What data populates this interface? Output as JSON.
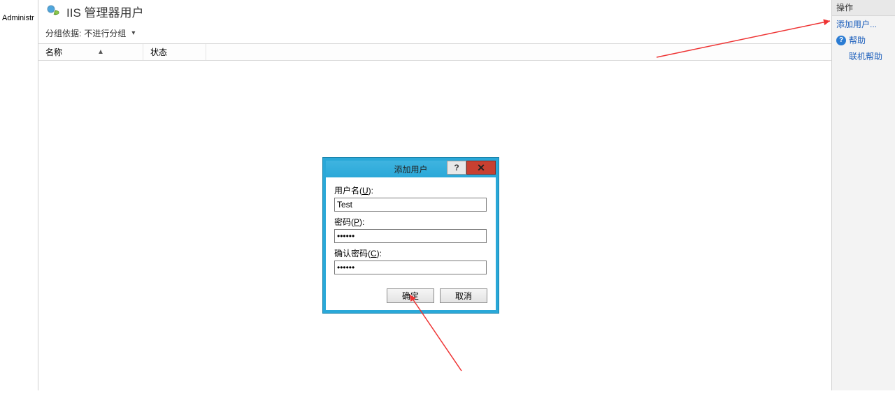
{
  "tree": {
    "root_label": "Administr"
  },
  "page": {
    "title": "IIS 管理器用户",
    "group_label": "分组依据:",
    "group_value": "不进行分组",
    "columns": {
      "name": "名称",
      "status": "状态"
    }
  },
  "actions": {
    "panel_title": "操作",
    "add_user": "添加用户...",
    "help": "帮助",
    "online_help": "联机帮助"
  },
  "dialog": {
    "title": "添加用户",
    "help_glyph": "?",
    "close_glyph": "✕",
    "username_label_pre": "用户名(",
    "username_label_key": "U",
    "username_label_post": "):",
    "username_value": "Test",
    "password_label_pre": "密码(",
    "password_label_key": "P",
    "password_label_post": "):",
    "password_value": "••••••",
    "confirm_label_pre": "确认密码(",
    "confirm_label_key": "C",
    "confirm_label_post": "):",
    "confirm_value": "••••••",
    "ok": "确定",
    "cancel": "取消"
  },
  "icons": {
    "sort_arrow": "▲",
    "dropdown": "▾"
  }
}
